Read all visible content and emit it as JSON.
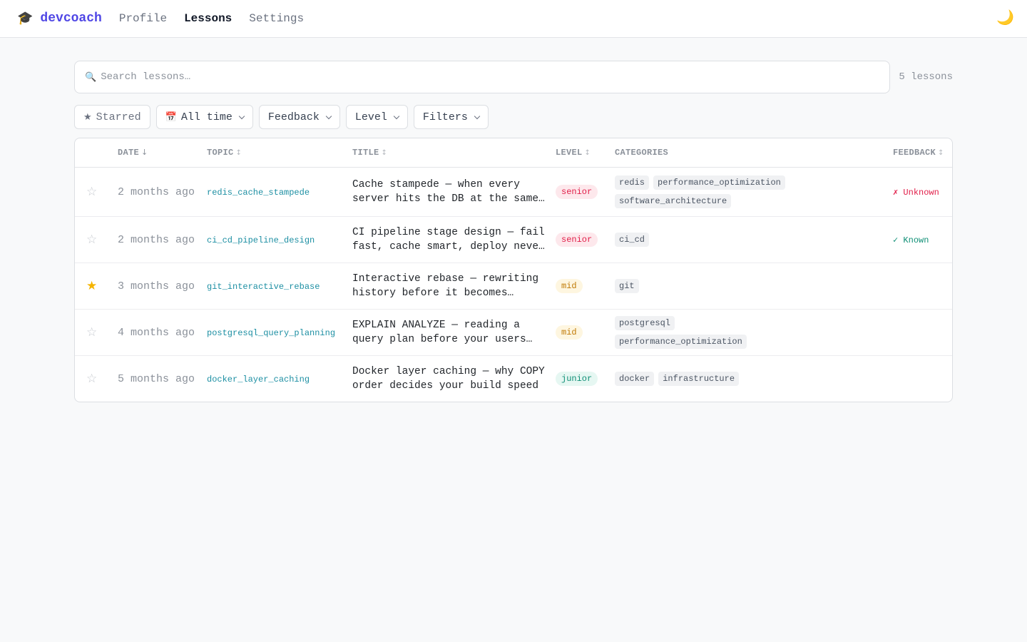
{
  "app": {
    "name": "devcoach",
    "logo_icon": "graduation-cap-icon"
  },
  "nav": {
    "links": [
      {
        "label": "Profile",
        "active": false
      },
      {
        "label": "Lessons",
        "active": true
      },
      {
        "label": "Settings",
        "active": false
      }
    ],
    "theme_icon": "moon-icon"
  },
  "search": {
    "placeholder": "Search lessons…",
    "value": "",
    "count_label": "5 lessons"
  },
  "filters": {
    "starred": "Starred",
    "time": "All time",
    "feedback": "Feedback",
    "level": "Level",
    "more": "Filters"
  },
  "table": {
    "headers": {
      "date": "DATE",
      "topic": "TOPIC",
      "title": "TITLE",
      "level": "LEVEL",
      "categories": "CATEGORIES",
      "feedback": "FEEDBACK"
    },
    "sort": {
      "column": "date",
      "direction": "desc"
    },
    "rows": [
      {
        "starred": false,
        "date": "2 months ago",
        "topic": "redis_cache_stampede",
        "title": "Cache stampede — when every server hits the DB at the same time",
        "level": "senior",
        "categories": [
          "redis",
          "performance_optimization",
          "software_architecture"
        ],
        "feedback": "✗ Unknown",
        "feedback_state": "unknown"
      },
      {
        "starred": false,
        "date": "2 months ago",
        "topic": "ci_cd_pipeline_design",
        "title": "CI pipeline stage design — fail fast, cache smart, deploy never manually",
        "level": "senior",
        "categories": [
          "ci_cd"
        ],
        "feedback": "✓ Known",
        "feedback_state": "known"
      },
      {
        "starred": true,
        "date": "3 months ago",
        "topic": "git_interactive_rebase",
        "title": "Interactive rebase — rewriting history before it becomes permanent",
        "level": "mid",
        "categories": [
          "git"
        ],
        "feedback": "",
        "feedback_state": "none"
      },
      {
        "starred": false,
        "date": "4 months ago",
        "topic": "postgresql_query_planning",
        "title": "EXPLAIN ANALYZE — reading a query plan before your users complain",
        "level": "mid",
        "categories": [
          "postgresql",
          "performance_optimization"
        ],
        "feedback": "",
        "feedback_state": "none"
      },
      {
        "starred": false,
        "date": "5 months ago",
        "topic": "docker_layer_caching",
        "title": "Docker layer caching — why COPY order decides your build speed",
        "level": "junior",
        "categories": [
          "docker",
          "infrastructure"
        ],
        "feedback": "",
        "feedback_state": "none"
      }
    ]
  },
  "colors": {
    "brand": "#4f46e5",
    "topic": "#1d8fa3",
    "senior": "#e11d48",
    "mid": "#c07a06",
    "junior": "#0f8f76",
    "star_active": "#f5b400"
  }
}
